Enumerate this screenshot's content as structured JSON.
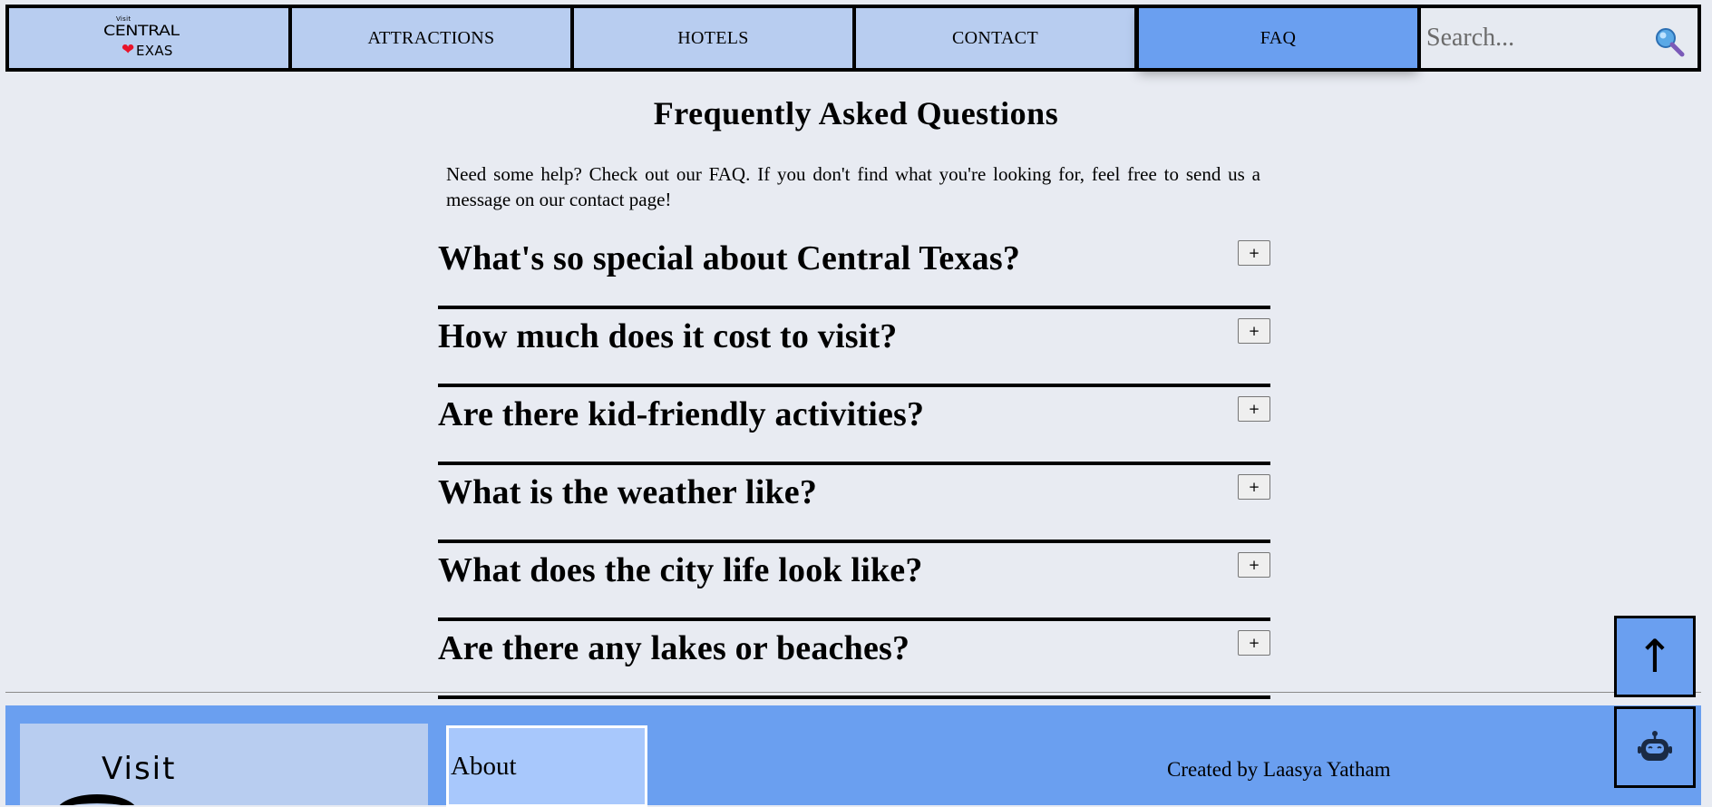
{
  "nav": {
    "logo": {
      "visit": "Visit",
      "central": "CENTRAL",
      "texas": "EXAS"
    },
    "items": [
      {
        "label": "ATTRACTIONS"
      },
      {
        "label": "HOTELS"
      },
      {
        "label": "CONTACT"
      },
      {
        "label": "FAQ",
        "active": true
      }
    ],
    "search": {
      "placeholder": "Search..."
    }
  },
  "main": {
    "title": "Frequently Asked Questions",
    "intro": "Need some help? Check out our FAQ. If you don't find what you're looking for, feel free to send us a message on our contact page!",
    "faqs": [
      {
        "question": "What's so special about Central Texas?",
        "toggle": "+"
      },
      {
        "question": "How much does it cost to visit?",
        "toggle": "+"
      },
      {
        "question": "Are there kid-friendly activities?",
        "toggle": "+"
      },
      {
        "question": "What is the weather like?",
        "toggle": "+"
      },
      {
        "question": "What does the city life look like?",
        "toggle": "+"
      },
      {
        "question": "Are there any lakes or beaches?",
        "toggle": "+"
      }
    ]
  },
  "floating": {
    "back_to_top": "↑",
    "chatbot_icon": "robot-icon"
  },
  "footer": {
    "logo_visit": "Visit",
    "about": "About",
    "credit": "Created by Laasya Yatham"
  },
  "colors": {
    "accent": "#6a9ff0",
    "nav_bg": "#b8cdf0",
    "page_bg": "#e8ebf2",
    "heart": "#e8132a"
  }
}
